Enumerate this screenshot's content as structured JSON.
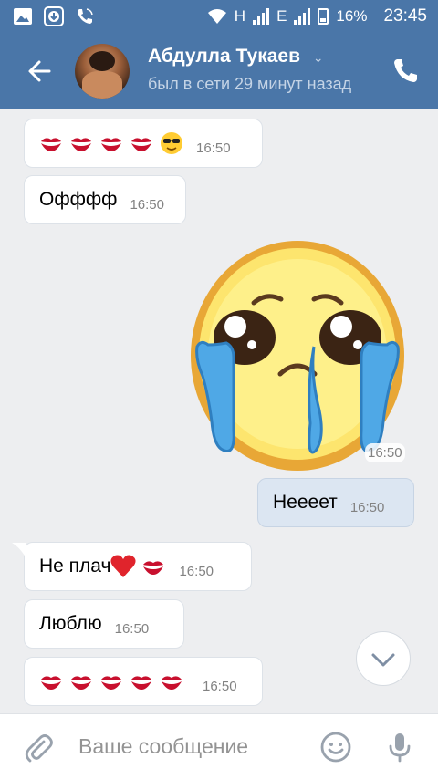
{
  "status_bar": {
    "network_h": "H",
    "network_e": "E",
    "battery_percent": "16%",
    "time": "23:45",
    "icons": [
      "image-icon",
      "download-icon",
      "wifi-call-icon",
      "wifi-icon",
      "signal-icon",
      "battery-icon"
    ]
  },
  "header": {
    "contact_name": "Абдулла Тукаев",
    "last_seen": "был в сети 29 минут назад",
    "colors": {
      "bar": "#4a76a8",
      "subtitle": "#c5d4e6"
    }
  },
  "messages": [
    {
      "direction": "in",
      "text": "",
      "emoji": [
        "kiss",
        "kiss",
        "kiss",
        "kiss",
        "smiling-face-with-sunglasses"
      ],
      "time": "16:50"
    },
    {
      "direction": "in",
      "text": "Офффф",
      "time": "16:50"
    },
    {
      "direction": "out",
      "sticker": "crying-face-sticker",
      "time": "16:50"
    },
    {
      "direction": "out",
      "text": "Нееeет",
      "time": "16:50"
    },
    {
      "direction": "in",
      "text": "Не плач",
      "emoji": [
        "red-heart",
        "kiss"
      ],
      "time": "16:50"
    },
    {
      "direction": "in",
      "text": "Люблю",
      "time": "16:50"
    },
    {
      "direction": "in",
      "text": "",
      "emoji": [
        "kiss",
        "kiss",
        "kiss",
        "kiss",
        "kiss"
      ],
      "time": "16:50"
    }
  ],
  "composer": {
    "placeholder": "Ваше сообщение"
  }
}
